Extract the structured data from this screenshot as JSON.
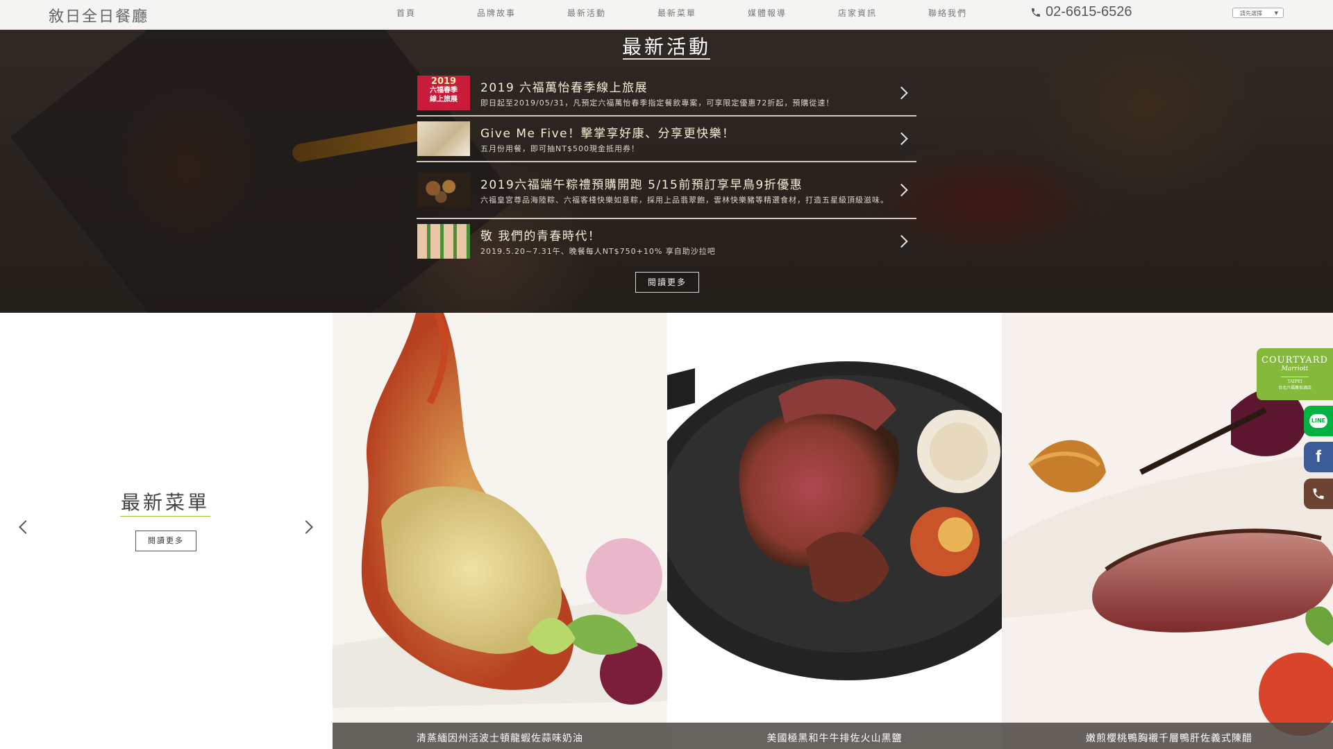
{
  "header": {
    "logo": "敘日全日餐廳",
    "nav": [
      "首頁",
      "品牌故事",
      "最新活動",
      "最新菜單",
      "媒體報導",
      "店家資訊",
      "聯絡我們"
    ],
    "phone": "02-6615-6526",
    "language_select": "請先選擇"
  },
  "activities": {
    "title": "最新活動",
    "items": [
      {
        "thumb_text": [
          "2019",
          "六福春季",
          "線上旅展"
        ],
        "title": "2019 六福萬怡春季線上旅展",
        "desc": "即日起至2019/05/31，凡預定六福萬怡春季指定餐飲專案，可享限定優惠72折起，預購從速！"
      },
      {
        "title": "Give Me Five！擊掌享好康、分享更快樂！",
        "desc": "五月份用餐，即可抽NT$500現金抵用券！"
      },
      {
        "title": "2019六福端午粽禮預購開跑 5/15前預訂享早鳥9折優惠",
        "desc": "六福皇宮尊品海陸粽、六福客棧快樂如意粽，採用上品翡翠飽，雲林快樂豬等精選食材，打造五星級頂級滋味。"
      },
      {
        "title": "敬 我們的青春時代！",
        "desc": "2019.5.20~7.31午、晚餐每人NT$750+10% 享自助沙拉吧"
      }
    ],
    "read_more": "閱讀更多"
  },
  "menu": {
    "title": "最新菜單",
    "read_more": "閱讀更多",
    "dishes": [
      "清蒸緬因州活波士頓龍蝦佐蒜味奶油",
      "美國極黑和牛牛排佐火山黑鹽",
      "嫩煎櫻桃鴨胸襯千層鴨肝佐義式陳醋"
    ]
  },
  "sidebar": {
    "courtyard_brand": "COURTYARD",
    "courtyard_sub": "Marriott",
    "courtyard_city": "TAIPEI",
    "courtyard_local": "台北六福萬怡酒店",
    "line_label": "LINE",
    "facebook_label": "f"
  },
  "colors": {
    "accent_green": "#84b93c",
    "line_green": "#00b341",
    "facebook_blue": "#3b5b99",
    "phone_brown": "#6d4434"
  }
}
